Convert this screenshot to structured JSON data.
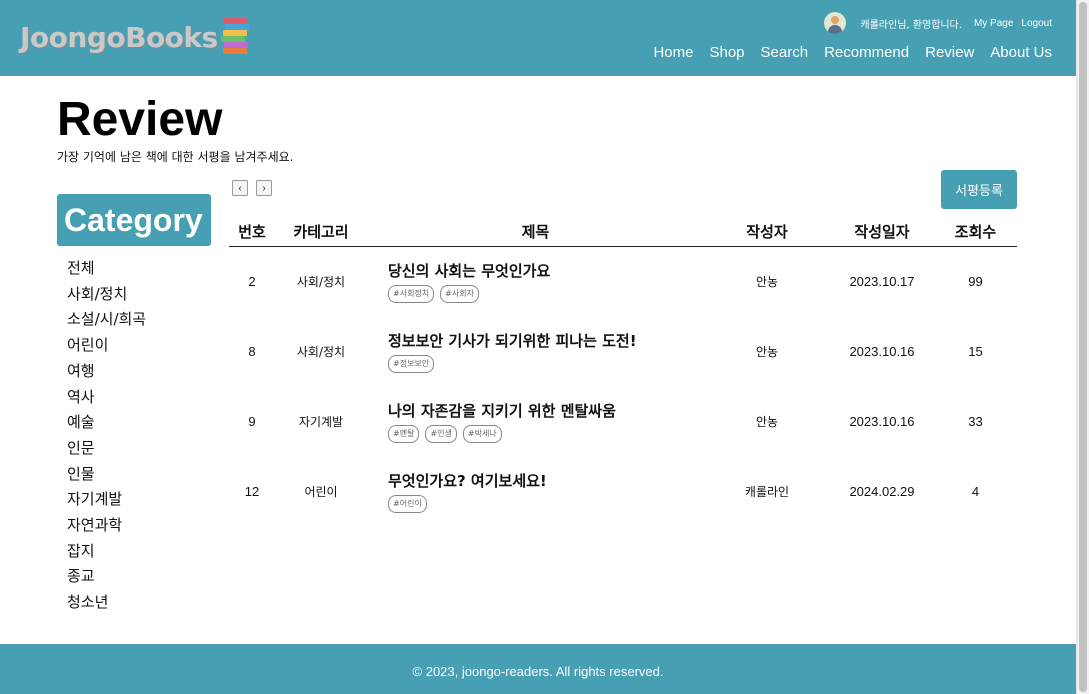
{
  "brand": {
    "logo_text": "JoongoBooks"
  },
  "user": {
    "welcome": "캐롤라인님, 환영합니다.",
    "mypage": "My Page",
    "logout": "Logout"
  },
  "nav": {
    "items": [
      "Home",
      "Shop",
      "Search",
      "Recommend",
      "Review",
      "About Us"
    ]
  },
  "page": {
    "title": "Review",
    "subtitle": "가장 기억에 남은 책에 대한 서평을 남겨주세요."
  },
  "sidebar": {
    "heading": "Category",
    "items": [
      "전체",
      "사회/정치",
      "소설/시/희곡",
      "어린이",
      "여행",
      "역사",
      "예술",
      "인문",
      "인물",
      "자기계발",
      "자연과학",
      "잡지",
      "종교",
      "청소년"
    ]
  },
  "pager": {
    "prev": "‹",
    "next": "›"
  },
  "actions": {
    "write_review": "서평등록"
  },
  "table": {
    "headers": [
      "번호",
      "카테고리",
      "제목",
      "작성자",
      "작성일자",
      "조회수"
    ],
    "rows": [
      {
        "no": "2",
        "category": "사회/정치",
        "title": "당신의 사회는 무엇인가요",
        "tags": [
          "#사회정치",
          "#사회자"
        ],
        "author": "안농",
        "date": "2023.10.17",
        "views": "99"
      },
      {
        "no": "8",
        "category": "사회/정치",
        "title": "정보보안 기사가 되기위한 피나는 도전!",
        "tags": [
          "#정보보안"
        ],
        "author": "안농",
        "date": "2023.10.16",
        "views": "15"
      },
      {
        "no": "9",
        "category": "자기계발",
        "title": "나의 자존감을 지키기 위한 멘탈싸움",
        "tags": [
          "#멘탈",
          "#인생",
          "#박세나"
        ],
        "author": "안농",
        "date": "2023.10.16",
        "views": "33"
      },
      {
        "no": "12",
        "category": "어린이",
        "title": "무엇인가요? 여기보세요!",
        "tags": [
          "#어린이"
        ],
        "author": "캐롤라인",
        "date": "2024.02.29",
        "views": "4"
      }
    ]
  },
  "footer": {
    "copyright": "© 2023, joongo-readers. All rights reserved."
  },
  "colors": {
    "primary": "#469fb2",
    "footer": "#469fb2"
  }
}
